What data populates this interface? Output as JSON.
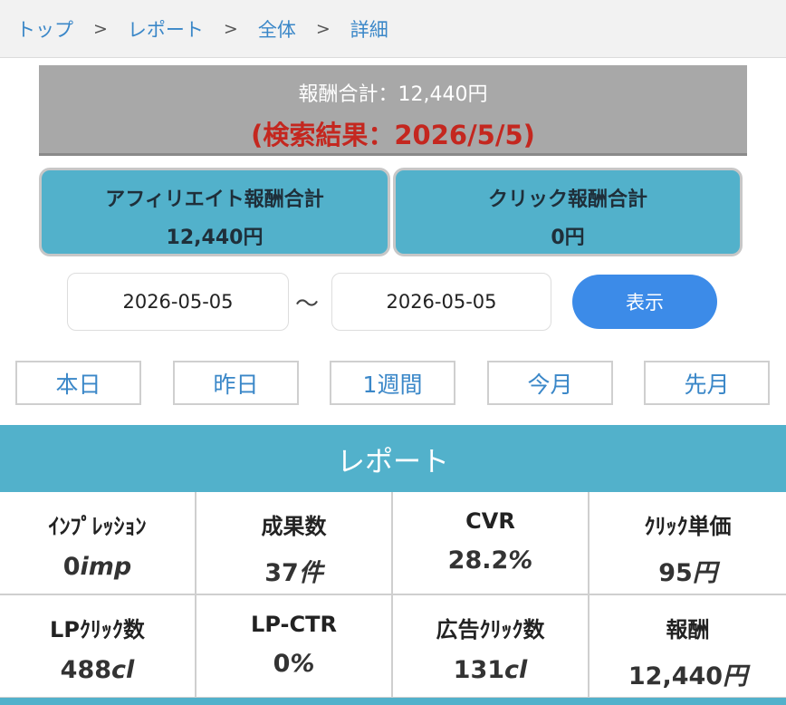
{
  "breadcrumb": {
    "items": [
      "トップ",
      "レポート",
      "全体",
      "詳細"
    ],
    "separator": ">"
  },
  "summary": {
    "total_text": "報酬合計：12,440円",
    "result_text": "(検索結果：2026/5/5)"
  },
  "cards": {
    "affiliate": {
      "label": "アフィリエイト報酬合計",
      "value": "12,440円"
    },
    "click": {
      "label": "クリック報酬合計",
      "value": "0円"
    }
  },
  "date_range": {
    "start": "2026-05-05",
    "end": "2026-05-05",
    "separator": "〜",
    "submit_label": "表示"
  },
  "presets": [
    "本日",
    "昨日",
    "1週間",
    "今月",
    "先月"
  ],
  "report": {
    "title": "レポート",
    "metrics": [
      {
        "label": "ｲﾝﾌﾟﾚｯｼｮﾝ",
        "value": "0",
        "unit": "imp"
      },
      {
        "label": "成果数",
        "value": "37",
        "unit": "件"
      },
      {
        "label": "CVR",
        "value": "28.2",
        "unit": "%"
      },
      {
        "label": "ｸﾘｯｸ単価",
        "value": "95",
        "unit": "円"
      },
      {
        "label": "LPｸﾘｯｸ数",
        "value": "488",
        "unit": "cl"
      },
      {
        "label": "LP-CTR",
        "value": "0",
        "unit": "%"
      },
      {
        "label": "広告ｸﾘｯｸ数",
        "value": "131",
        "unit": "cl"
      },
      {
        "label": "報酬",
        "value": "12,440",
        "unit": "円"
      }
    ]
  },
  "colors": {
    "accent": "#52b1cb",
    "link": "#3a87c8",
    "alert": "#c4271f",
    "button": "#3c8be8"
  }
}
